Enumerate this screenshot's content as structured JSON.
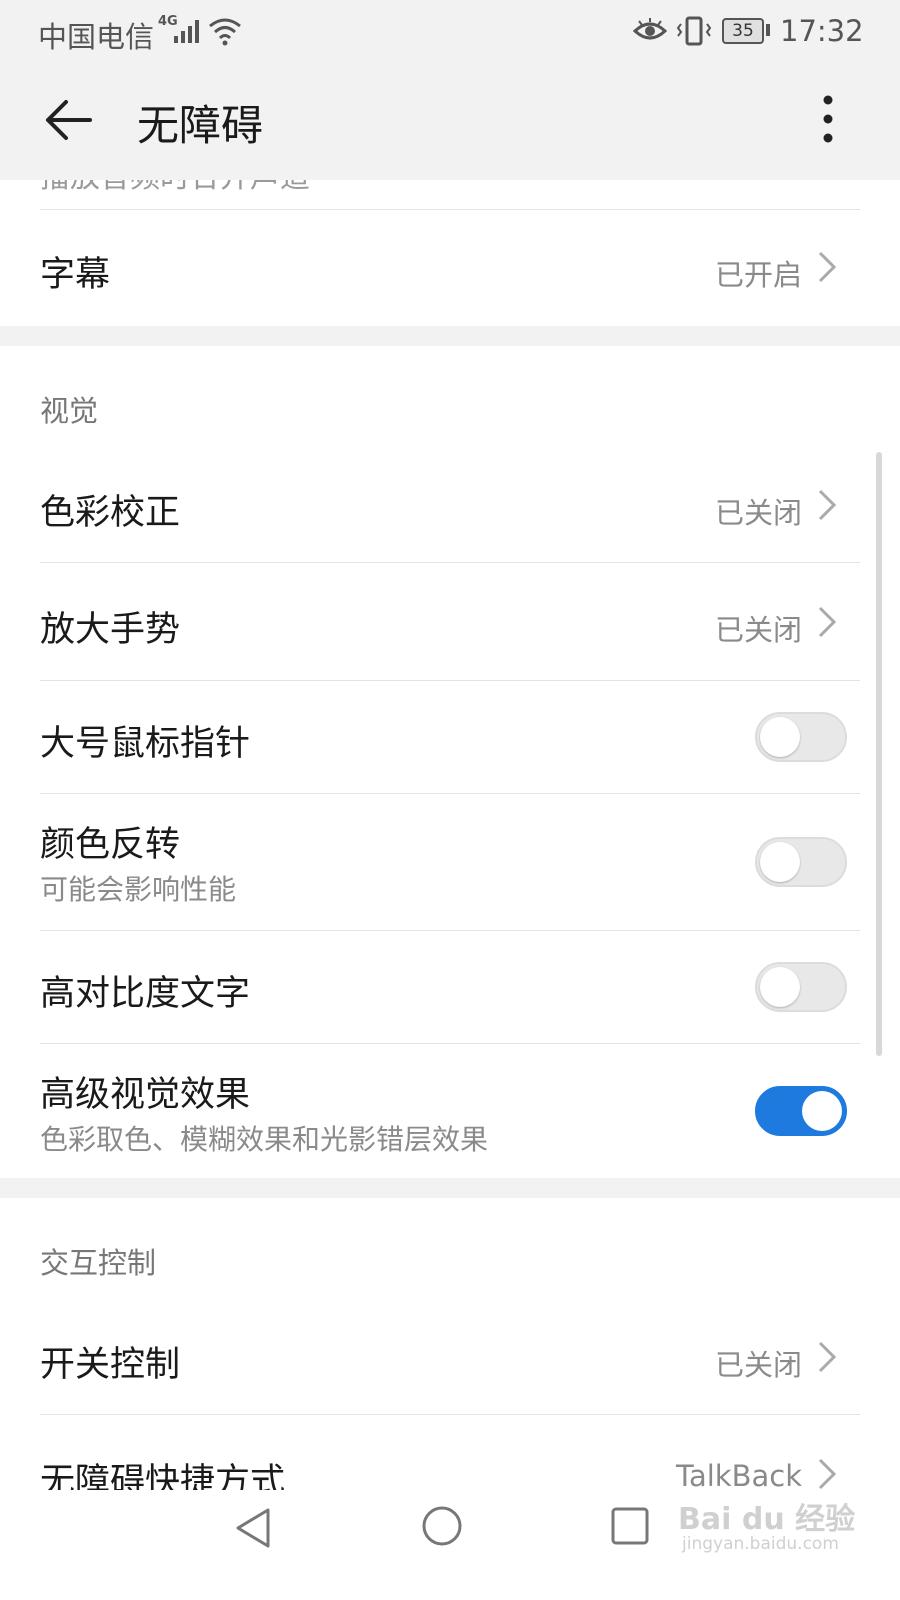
{
  "status_bar": {
    "carrier": "中国电信",
    "network": "4G",
    "battery": "35",
    "time": "17:32"
  },
  "app_bar": {
    "title": "无障碍"
  },
  "top_section": {
    "partial_label": "播放音频时合并声道",
    "captions": {
      "label": "字幕",
      "value": "已开启"
    }
  },
  "vision": {
    "header": "视觉",
    "color_correction": {
      "label": "色彩校正",
      "value": "已关闭"
    },
    "magnification": {
      "label": "放大手势",
      "value": "已关闭"
    },
    "large_pointer": {
      "label": "大号鼠标指针",
      "enabled": false
    },
    "color_inversion": {
      "label": "颜色反转",
      "sub": "可能会影响性能",
      "enabled": false
    },
    "high_contrast": {
      "label": "高对比度文字",
      "enabled": false
    },
    "advanced_visual": {
      "label": "高级视觉效果",
      "sub": "色彩取色、模糊效果和光影错层效果",
      "enabled": true
    }
  },
  "interaction": {
    "header": "交互控制",
    "switch_access": {
      "label": "开关控制",
      "value": "已关闭"
    },
    "shortcut": {
      "label": "无障碍快捷方式",
      "value": "TalkBack"
    }
  },
  "watermark": {
    "brand": "Bai du 经验",
    "url": "jingyan.baidu.com"
  },
  "colors": {
    "accent": "#1f7ae0",
    "background": "#f2f2f2",
    "card": "#ffffff"
  }
}
